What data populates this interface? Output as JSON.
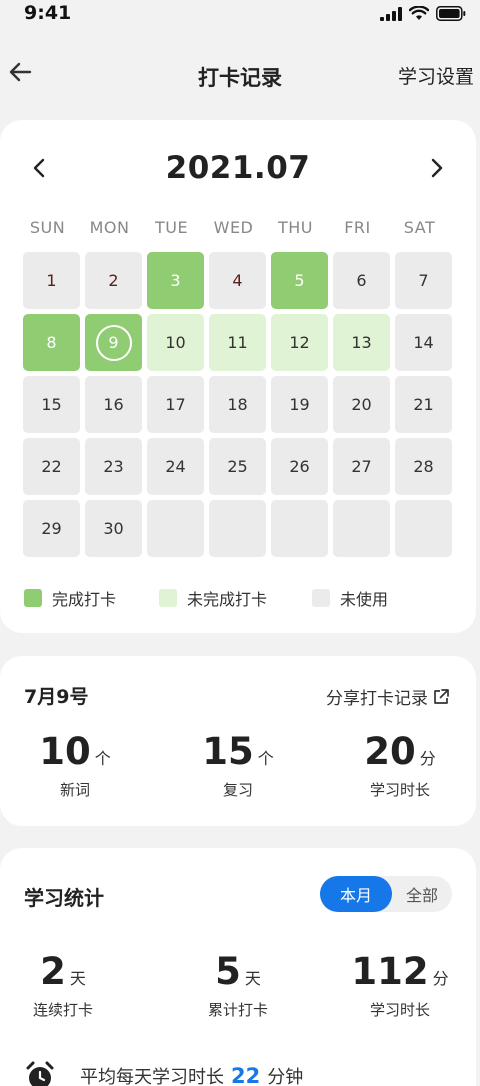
{
  "status": {
    "time": "9:41"
  },
  "nav": {
    "title": "打卡记录",
    "settings": "学习设置"
  },
  "calendar": {
    "month": "2021.07",
    "weekdays": [
      "SUN",
      "MON",
      "TUE",
      "WED",
      "THU",
      "FRI",
      "SAT"
    ],
    "days": [
      {
        "d": "1",
        "s": "past"
      },
      {
        "d": "2",
        "s": "past"
      },
      {
        "d": "3",
        "s": "done"
      },
      {
        "d": "4",
        "s": "past"
      },
      {
        "d": "5",
        "s": "done"
      },
      {
        "d": "6",
        "s": "unused"
      },
      {
        "d": "7",
        "s": "unused"
      },
      {
        "d": "8",
        "s": "done"
      },
      {
        "d": "9",
        "s": "today"
      },
      {
        "d": "10",
        "s": "partial"
      },
      {
        "d": "11",
        "s": "partial"
      },
      {
        "d": "12",
        "s": "partial"
      },
      {
        "d": "13",
        "s": "partial"
      },
      {
        "d": "14",
        "s": "unused"
      },
      {
        "d": "15",
        "s": "unused"
      },
      {
        "d": "16",
        "s": "unused"
      },
      {
        "d": "17",
        "s": "unused"
      },
      {
        "d": "18",
        "s": "unused"
      },
      {
        "d": "19",
        "s": "unused"
      },
      {
        "d": "20",
        "s": "unused"
      },
      {
        "d": "21",
        "s": "unused"
      },
      {
        "d": "22",
        "s": "unused"
      },
      {
        "d": "23",
        "s": "unused"
      },
      {
        "d": "24",
        "s": "unused"
      },
      {
        "d": "25",
        "s": "unused"
      },
      {
        "d": "26",
        "s": "unused"
      },
      {
        "d": "27",
        "s": "unused"
      },
      {
        "d": "28",
        "s": "unused"
      },
      {
        "d": "29",
        "s": "unused"
      },
      {
        "d": "30",
        "s": "unused"
      },
      {
        "d": "",
        "s": "empty"
      },
      {
        "d": "",
        "s": "empty"
      },
      {
        "d": "",
        "s": "empty"
      },
      {
        "d": "",
        "s": "empty"
      },
      {
        "d": "",
        "s": "empty"
      }
    ],
    "legend": {
      "done": "完成打卡",
      "partial": "未完成打卡",
      "unused": "未使用"
    }
  },
  "colors": {
    "done": "#90cc72",
    "partial": "#e0f3d4",
    "unused": "#ebebeb",
    "accent": "#1677e8"
  },
  "today": {
    "date": "7月9号",
    "share": "分享打卡记录",
    "stats": [
      {
        "value": "10",
        "unit": "个",
        "label": "新词"
      },
      {
        "value": "15",
        "unit": "个",
        "label": "复习"
      },
      {
        "value": "20",
        "unit": "分",
        "label": "学习时长"
      }
    ]
  },
  "study": {
    "title": "学习统计",
    "tab_month": "本月",
    "tab_all": "全部",
    "stats": [
      {
        "value": "2",
        "unit": "天",
        "label": "连续打卡"
      },
      {
        "value": "5",
        "unit": "天",
        "label": "累计打卡"
      },
      {
        "value": "112",
        "unit": "分",
        "label": "学习时长"
      }
    ],
    "avg_prefix": "平均每天学习时长",
    "avg_value": "22",
    "avg_unit": "分钟"
  }
}
